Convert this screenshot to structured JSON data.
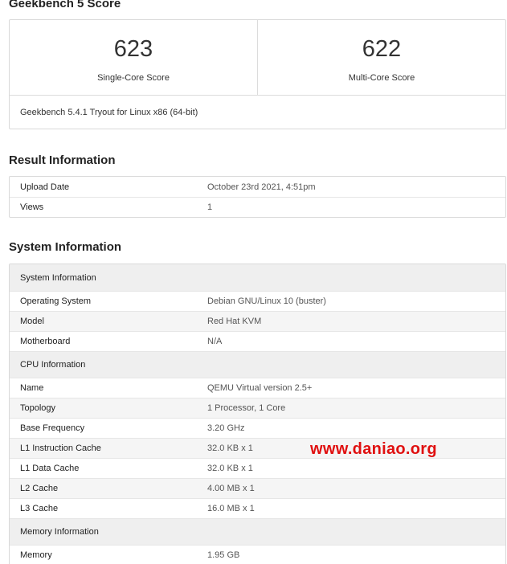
{
  "titles": {
    "score": "Geekbench 5 Score",
    "result": "Result Information",
    "system": "System Information"
  },
  "scores": {
    "single_value": "623",
    "single_label": "Single-Core Score",
    "multi_value": "622",
    "multi_label": "Multi-Core Score",
    "version": "Geekbench 5.4.1 Tryout for Linux x86 (64-bit)"
  },
  "result": [
    {
      "key": "Upload Date",
      "value": "October 23rd 2021, 4:51pm"
    },
    {
      "key": "Views",
      "value": "1"
    }
  ],
  "system": {
    "system_header": "System Information",
    "os_key": "Operating System",
    "os_value": "Debian GNU/Linux 10 (buster)",
    "model_key": "Model",
    "model_value": "Red Hat KVM",
    "mb_key": "Motherboard",
    "mb_value": "N/A",
    "cpu_header": "CPU Information",
    "name_key": "Name",
    "name_value": "QEMU Virtual version 2.5+",
    "topo_key": "Topology",
    "topo_value": "1 Processor, 1 Core",
    "freq_key": "Base Frequency",
    "freq_value": "3.20 GHz",
    "l1i_key": "L1 Instruction Cache",
    "l1i_value": "32.0 KB x 1",
    "l1d_key": "L1 Data Cache",
    "l1d_value": "32.0 KB x 1",
    "l2_key": "L2 Cache",
    "l2_value": "4.00 MB x 1",
    "l3_key": "L3 Cache",
    "l3_value": "16.0 MB x 1",
    "mem_header": "Memory Information",
    "mem_key": "Memory",
    "mem_value": "1.95 GB"
  },
  "watermark": "www.daniao.org"
}
